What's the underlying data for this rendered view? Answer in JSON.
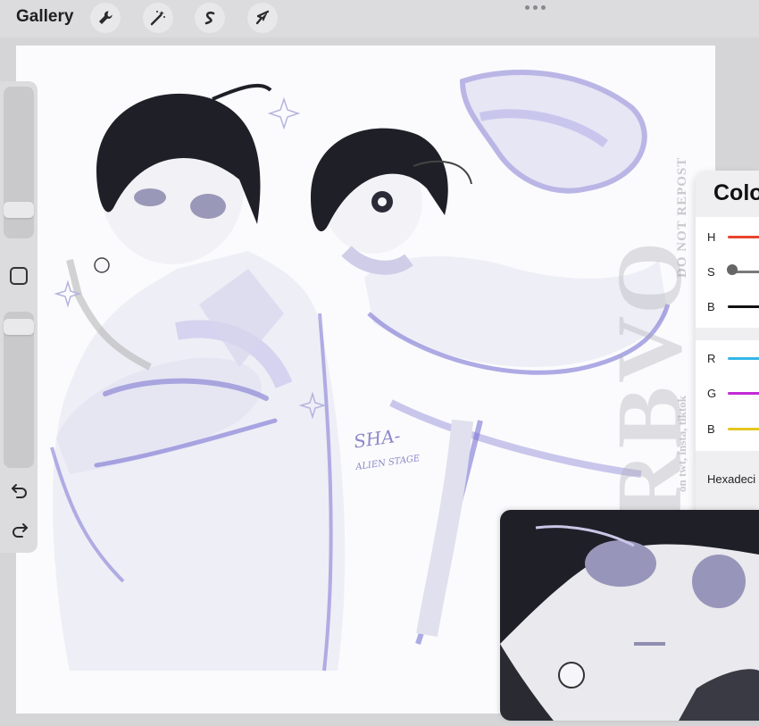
{
  "toolbar": {
    "gallery_label": "Gallery",
    "tools": [
      {
        "name": "actions",
        "icon": "wrench-icon"
      },
      {
        "name": "adjustments",
        "icon": "magic-wand-icon"
      },
      {
        "name": "selection",
        "icon": "selection-s-icon"
      },
      {
        "name": "transform",
        "icon": "arrow-cursor-icon"
      }
    ],
    "more_icon": "three-dots-icon"
  },
  "canvas": {
    "watermark_main": "KKRBVO",
    "watermark_sub": "DO NOT REPOST",
    "watermark_socials": "on twt, insta, tiktok",
    "signature": "SHA-",
    "signature_sub": "ALIEN STAGE"
  },
  "sidebar": {
    "brush_size_level": 0.15,
    "opacity_level": 0.05,
    "modify_icon": "square-icon",
    "undo_icon": "undo-icon",
    "redo_icon": "redo-icon"
  },
  "color_panel": {
    "title": "Colo",
    "hsb": [
      {
        "label": "H",
        "color": "#e8442c"
      },
      {
        "label": "S",
        "color": "#7a7a7a"
      },
      {
        "label": "B",
        "color": "#111111"
      }
    ],
    "rgb": [
      {
        "label": "R",
        "color": "#35b6e8"
      },
      {
        "label": "G",
        "color": "#c22bd6"
      },
      {
        "label": "B",
        "color": "#e5c622"
      }
    ],
    "hex_label": "Hexadeci"
  },
  "colors": {
    "accent_lilac": "#8f8ad6",
    "ink": "#1d1d24"
  }
}
